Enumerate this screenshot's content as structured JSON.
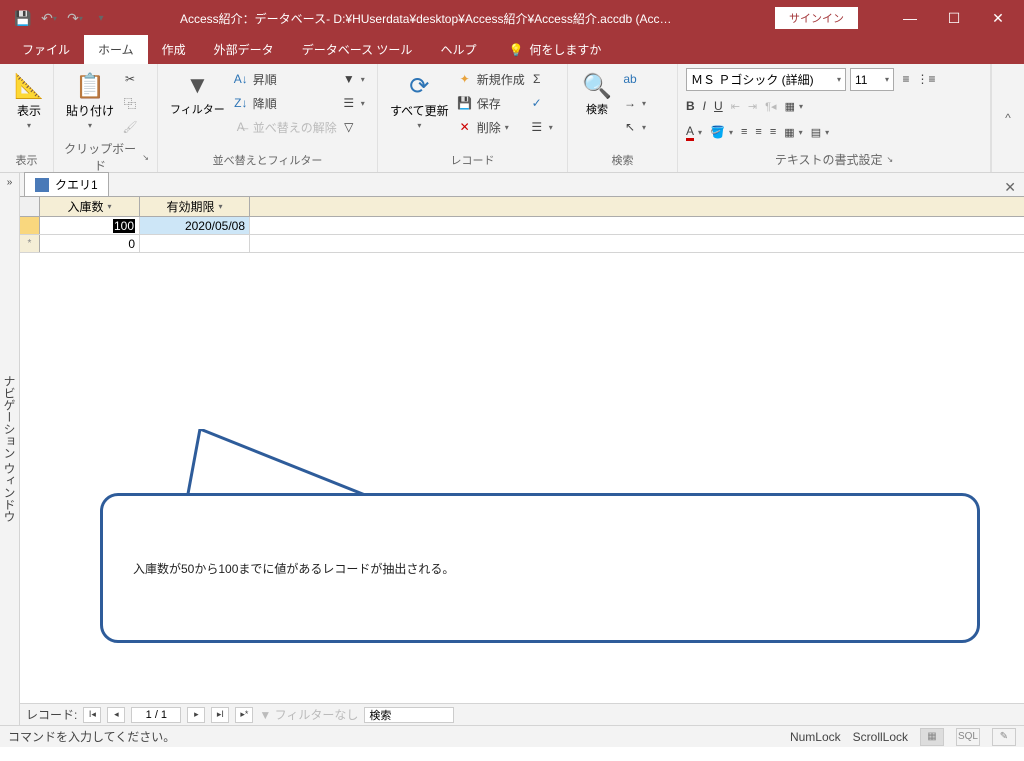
{
  "titlebar": {
    "title": "Access紹介：データベース- D:¥HUserdata¥desktop¥Access紹介¥Access紹介.accdb (Acc…",
    "signin": "サインイン"
  },
  "tabs": {
    "file": "ファイル",
    "home": "ホーム",
    "create": "作成",
    "external": "外部データ",
    "dbtools": "データベース ツール",
    "help": "ヘルプ",
    "tellme": "何をしますか"
  },
  "ribbon": {
    "view": {
      "label": "表示",
      "group": "表示"
    },
    "clipboard": {
      "paste": "貼り付け",
      "group": "クリップボード"
    },
    "sortfilter": {
      "filter": "フィルター",
      "asc": "昇順",
      "desc": "降順",
      "clear": "並べ替えの解除",
      "group": "並べ替えとフィルター"
    },
    "records": {
      "refresh": "すべて更新",
      "new": "新規作成",
      "save": "保存",
      "delete": "削除",
      "group": "レコード"
    },
    "find": {
      "find": "検索",
      "group": "検索"
    },
    "textfmt": {
      "font": "ＭＳ Ｐゴシック (詳細)",
      "size": "11",
      "group": "テキストの書式設定"
    }
  },
  "navpane": {
    "label": "ナビゲーション ウィンドウ"
  },
  "doctab": {
    "name": "クエリ1"
  },
  "grid": {
    "col1": "入庫数",
    "col2": "有効期限",
    "row1": {
      "a": "100",
      "b": "2020/05/08"
    },
    "row2": {
      "a": "0"
    }
  },
  "callout": {
    "text": "入庫数が50から100までに値があるレコードが抽出される。"
  },
  "recnav": {
    "label": "レコード:",
    "pos": "1 / 1",
    "nofilter": "フィルターなし",
    "search": "検索"
  },
  "status": {
    "msg": "コマンドを入力してください。",
    "numlock": "NumLock",
    "scrolllock": "ScrollLock",
    "sql": "SQL"
  }
}
